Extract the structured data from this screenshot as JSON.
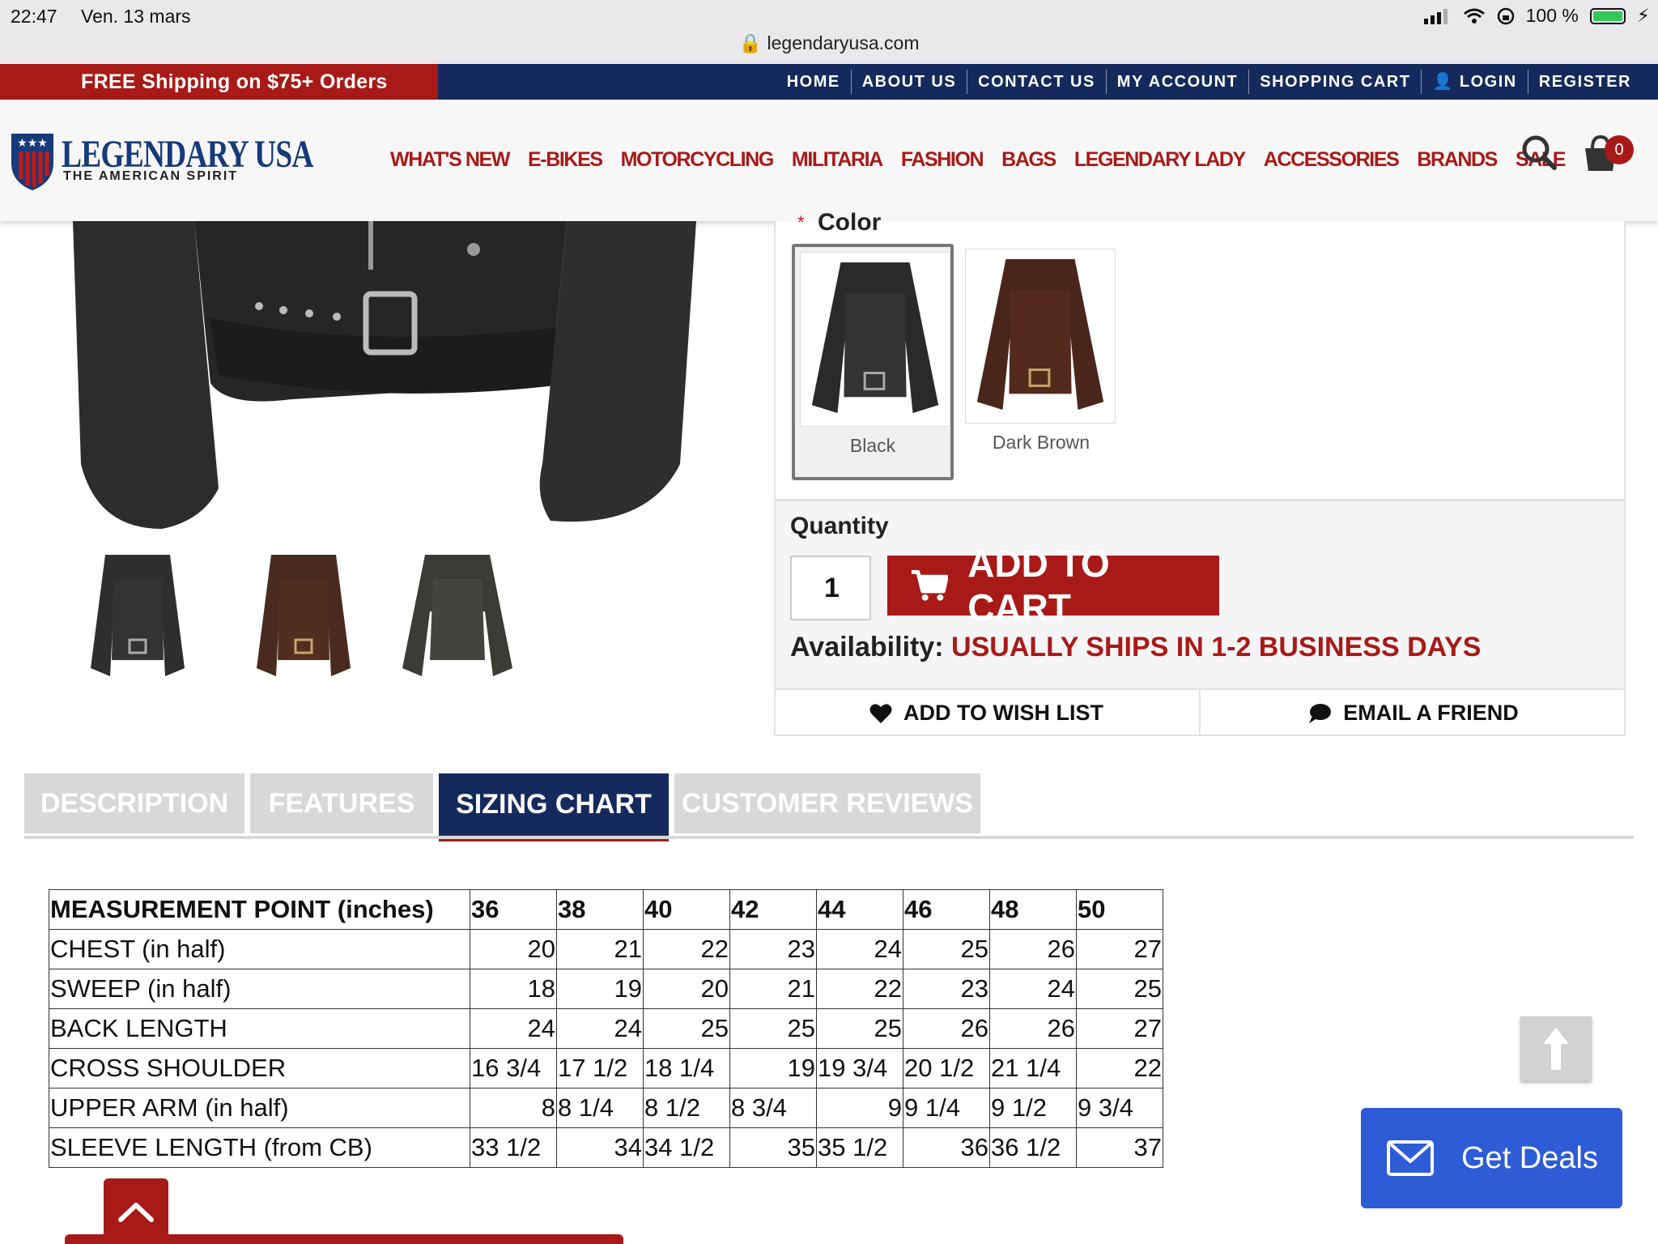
{
  "status_bar": {
    "time": "22:47",
    "date": "Ven. 13 mars",
    "url": "legendaryusa.com",
    "battery": "100 %"
  },
  "promo": {
    "shipping": "FREE Shipping on $75+ Orders"
  },
  "top_nav": [
    "HOME",
    "ABOUT US",
    "CONTACT US",
    "MY ACCOUNT",
    "SHOPPING CART"
  ],
  "auth": {
    "login": "LOGIN",
    "register": "REGISTER"
  },
  "logo": {
    "name": "LEGENDARY USA",
    "tagline": "THE AMERICAN SPIRIT"
  },
  "main_nav": [
    "WHAT'S NEW",
    "E-BIKES",
    "MOTORCYCLING",
    "MILITARIA",
    "FASHION",
    "BAGS",
    "LEGENDARY LADY",
    "ACCESSORIES",
    "BRANDS",
    "SALE"
  ],
  "cart": {
    "count": "0"
  },
  "colors": {
    "label": "Color",
    "options": [
      {
        "label": "Black",
        "selected": true
      },
      {
        "label": "Dark Brown",
        "selected": false
      }
    ]
  },
  "purchase": {
    "quantity_label": "Quantity",
    "quantity_value": "1",
    "add_to_cart": "ADD TO CART",
    "availability_label": "Availability:",
    "availability_value": "USUALLY SHIPS IN 1-2 BUSINESS DAYS",
    "wish_list": "ADD TO WISH LIST",
    "email_friend": "EMAIL A FRIEND"
  },
  "tabs": [
    {
      "label": "DESCRIPTION",
      "active": false
    },
    {
      "label": "FEATURES",
      "active": false
    },
    {
      "label": "SIZING CHART",
      "active": true
    },
    {
      "label": "CUSTOMER REVIEWS",
      "active": false
    }
  ],
  "sizing": {
    "header": [
      "MEASUREMENT POINT (inches)",
      "36",
      "38",
      "40",
      "42",
      "44",
      "46",
      "48",
      "50"
    ],
    "rows": [
      [
        "CHEST (in half)",
        "20",
        "21",
        "22",
        "23",
        "24",
        "25",
        "26",
        "27"
      ],
      [
        "SWEEP (in half)",
        "18",
        "19",
        "20",
        "21",
        "22",
        "23",
        "24",
        "25"
      ],
      [
        "BACK LENGTH",
        "24",
        "24",
        "25",
        "25",
        "25",
        "26",
        "26",
        "27"
      ],
      [
        "CROSS SHOULDER",
        "16 3/4",
        "17 1/2",
        "18 1/4",
        "19",
        "19 3/4",
        "20 1/2",
        "21 1/4",
        "22"
      ],
      [
        "UPPER ARM (in half)",
        "8",
        "8 1/4",
        "8 1/2",
        "8 3/4",
        "9",
        "9 1/4",
        "9 1/2",
        "9 3/4"
      ],
      [
        "SLEEVE LENGTH (from CB)",
        "33 1/2",
        "34",
        "34 1/2",
        "35",
        "35 1/2",
        "36",
        "36 1/2",
        "37"
      ]
    ]
  },
  "deals": {
    "label": "Get Deals"
  },
  "theme": {
    "brand_red": "#a81a17",
    "brand_navy": "#142a5c",
    "deals_blue": "#2d5cd6"
  }
}
